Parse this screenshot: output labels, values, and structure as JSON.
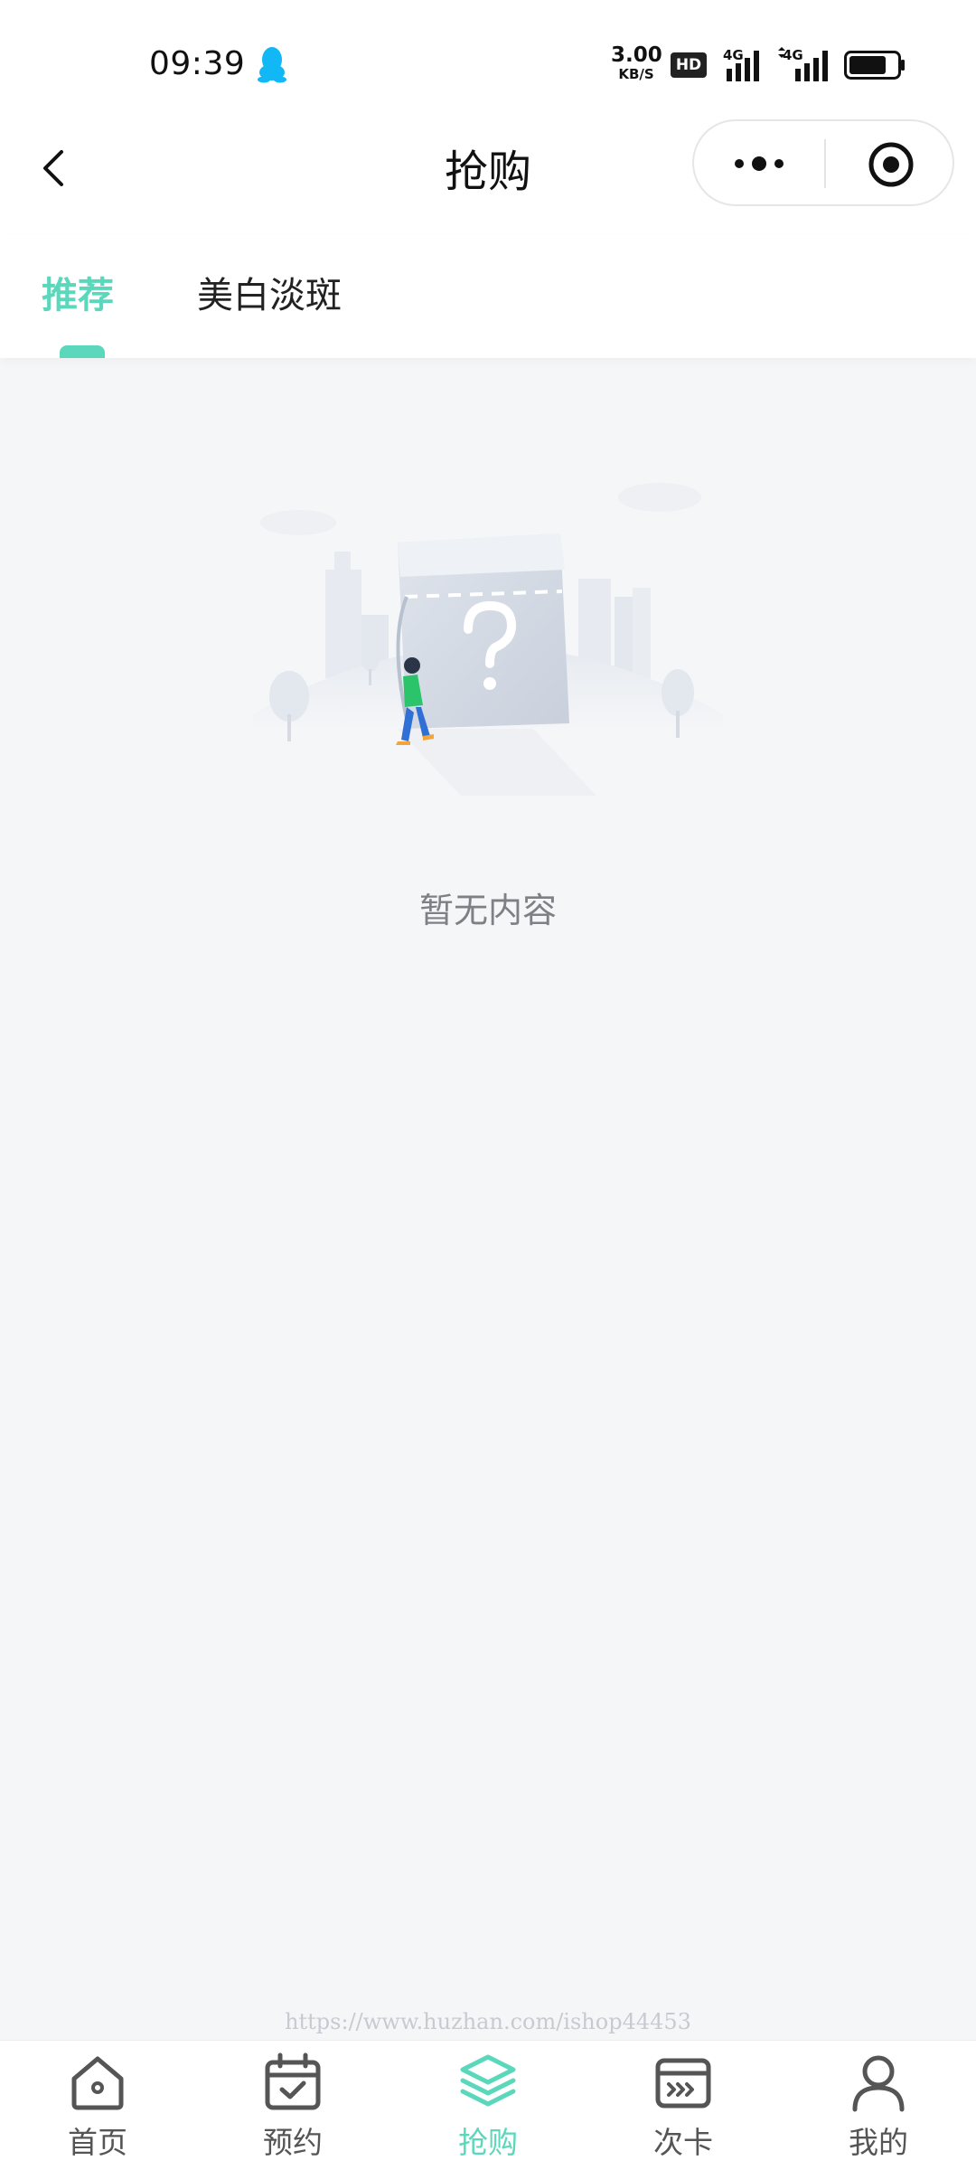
{
  "status_bar": {
    "time": "09:39",
    "notification_icon": "qq-penguin-icon",
    "net_speed_value": "3.00",
    "net_speed_unit": "KB/S",
    "hd_badge": "HD",
    "signal_1_label": "4G",
    "signal_2_label": "4G",
    "battery_icon": "battery-icon"
  },
  "nav": {
    "back_icon": "chevron-left-icon",
    "title": "抢购",
    "more_icon": "more-dots-icon",
    "close_icon": "target-circle-icon"
  },
  "tabs": [
    {
      "label": "推荐",
      "active": true
    },
    {
      "label": "美白淡斑",
      "active": false
    }
  ],
  "empty_state": {
    "illustration": "empty-box-illustration",
    "text": "暂无内容"
  },
  "watermark": "https://www.huzhan.com/ishop44453",
  "tab_bar": {
    "items": [
      {
        "label": "首页",
        "icon": "home-icon",
        "active": false
      },
      {
        "label": "预约",
        "icon": "calendar-check-icon",
        "active": false
      },
      {
        "label": "抢购",
        "icon": "layers-icon",
        "active": true
      },
      {
        "label": "次卡",
        "icon": "card-icon",
        "active": false
      },
      {
        "label": "我的",
        "icon": "user-icon",
        "active": false
      }
    ]
  },
  "colors": {
    "accent": "#5bd8bc",
    "background": "#f5f6f8",
    "text_muted": "#7d8085"
  }
}
